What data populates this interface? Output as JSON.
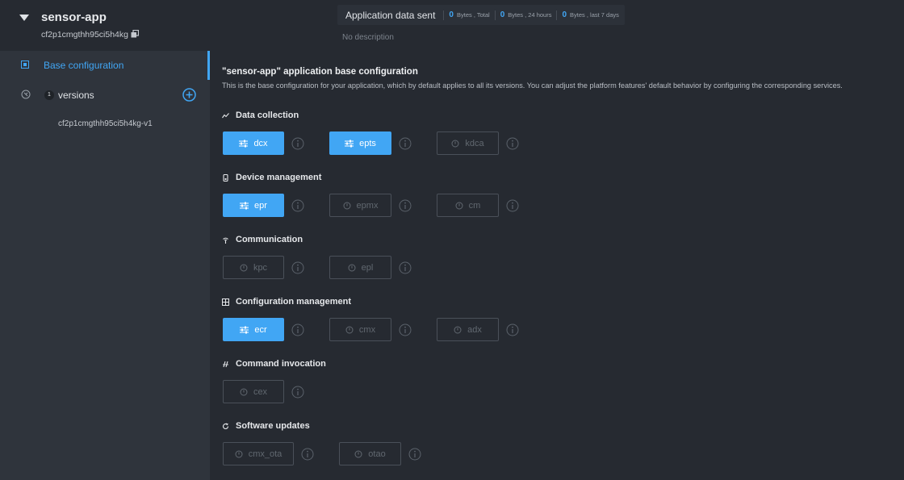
{
  "app": {
    "name": "sensor-app",
    "id": "cf2p1cmgthh95ci5h4kg"
  },
  "stats": {
    "title": "Application data sent",
    "items": [
      {
        "value": "0",
        "unit": "Bytes , Total"
      },
      {
        "value": "0",
        "unit": "Bytes , 24 hours"
      },
      {
        "value": "0",
        "unit": "Bytes , last 7 days"
      }
    ],
    "description": "No description"
  },
  "sidebar": {
    "base_label": "Base configuration",
    "versions_count": "1",
    "versions_label": "versions",
    "version_items": [
      "cf2p1cmgthh95ci5h4kg-v1"
    ]
  },
  "main": {
    "title": "\"sensor-app\" application base configuration",
    "subtitle": "This is the base configuration for your application, which by default applies to all its versions. You can adjust the platform features' default behavior by configuring the corresponding services.",
    "sections": [
      {
        "title": "Data collection",
        "icon": "chart-line-icon",
        "features": [
          {
            "label": "dcx",
            "enabled": true
          },
          {
            "label": "epts",
            "enabled": true
          },
          {
            "label": "kdca",
            "enabled": false
          }
        ]
      },
      {
        "title": "Device management",
        "icon": "device-icon",
        "features": [
          {
            "label": "epr",
            "enabled": true
          },
          {
            "label": "epmx",
            "enabled": false
          },
          {
            "label": "cm",
            "enabled": false
          }
        ]
      },
      {
        "title": "Communication",
        "icon": "antenna-icon",
        "features": [
          {
            "label": "kpc",
            "enabled": false
          },
          {
            "label": "epl",
            "enabled": false
          }
        ]
      },
      {
        "title": "Configuration management",
        "icon": "grid-icon",
        "features": [
          {
            "label": "ecr",
            "enabled": true
          },
          {
            "label": "cmx",
            "enabled": false
          },
          {
            "label": "adx",
            "enabled": false
          }
        ]
      },
      {
        "title": "Command invocation",
        "icon": "command-icon",
        "features": [
          {
            "label": "cex",
            "enabled": false
          }
        ]
      },
      {
        "title": "Software updates",
        "icon": "update-icon",
        "features": [
          {
            "label": "cmx_ota",
            "enabled": false
          },
          {
            "label": "otao",
            "enabled": false
          }
        ]
      }
    ]
  },
  "colors": {
    "accent": "#41a6f4",
    "background": "#262a31",
    "sidebar": "#2f343c"
  }
}
